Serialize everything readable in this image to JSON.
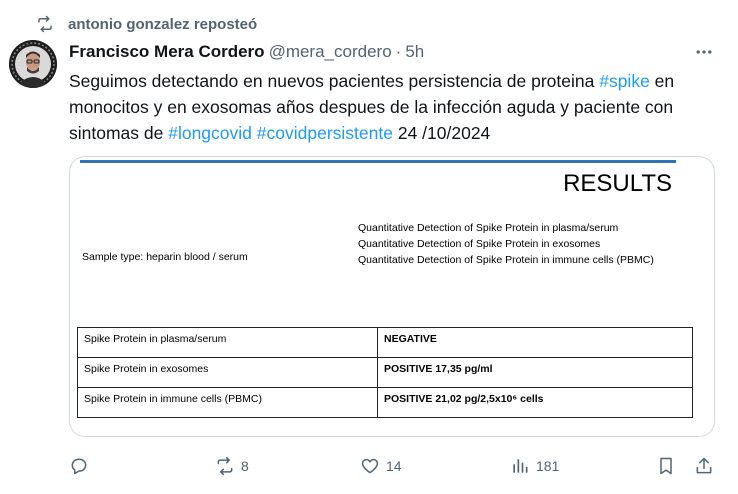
{
  "repost": {
    "text": "antonio gonzalez reposteó"
  },
  "author": {
    "name": "Francisco Mera Cordero",
    "handle": "@mera_cordero",
    "separator": "·",
    "time": "5h"
  },
  "tweet": {
    "part1": "Seguimos detectando en nuevos pacientes persistencia de proteina ",
    "tag1": "#spike",
    "part2": " en monocitos y en exosomas  años despues de la infección aguda y paciente con sintomas de ",
    "tag2": "#longcovid",
    "part3": " ",
    "tag3": "#covidpersistente",
    "part4": " 24 /10/2024"
  },
  "media": {
    "title": "RESULTS",
    "sample_type": "Sample type: heparin blood / serum",
    "quant_lines": [
      "Quantitative Detection of Spike Protein in plasma/serum",
      "Quantitative Detection of Spike Protein in exosomes",
      "Quantitative Detection of Spike Protein in immune cells (PBMC)"
    ],
    "rows": [
      {
        "label": "Spike Protein in plasma/serum",
        "value": "NEGATIVE"
      },
      {
        "label": "Spike Protein in exosomes",
        "value": "POSITIVE 17,35 pg/ml"
      },
      {
        "label": "Spike Protein in immune cells (PBMC)",
        "value": "POSITIVE 21,02 pg/2,5x10⁶ cells"
      }
    ]
  },
  "actions": {
    "reposts": "8",
    "likes": "14",
    "views": "181"
  },
  "icons": {
    "repost": "repost-icon",
    "more": "more-icon",
    "reply": "reply-icon",
    "like": "heart-icon",
    "views": "views-icon",
    "bookmark": "bookmark-icon",
    "share": "share-icon"
  },
  "colors": {
    "link": "#1d9bf0",
    "muted": "#536471",
    "text": "#0f1419",
    "accent_bar": "#2e74b5"
  }
}
